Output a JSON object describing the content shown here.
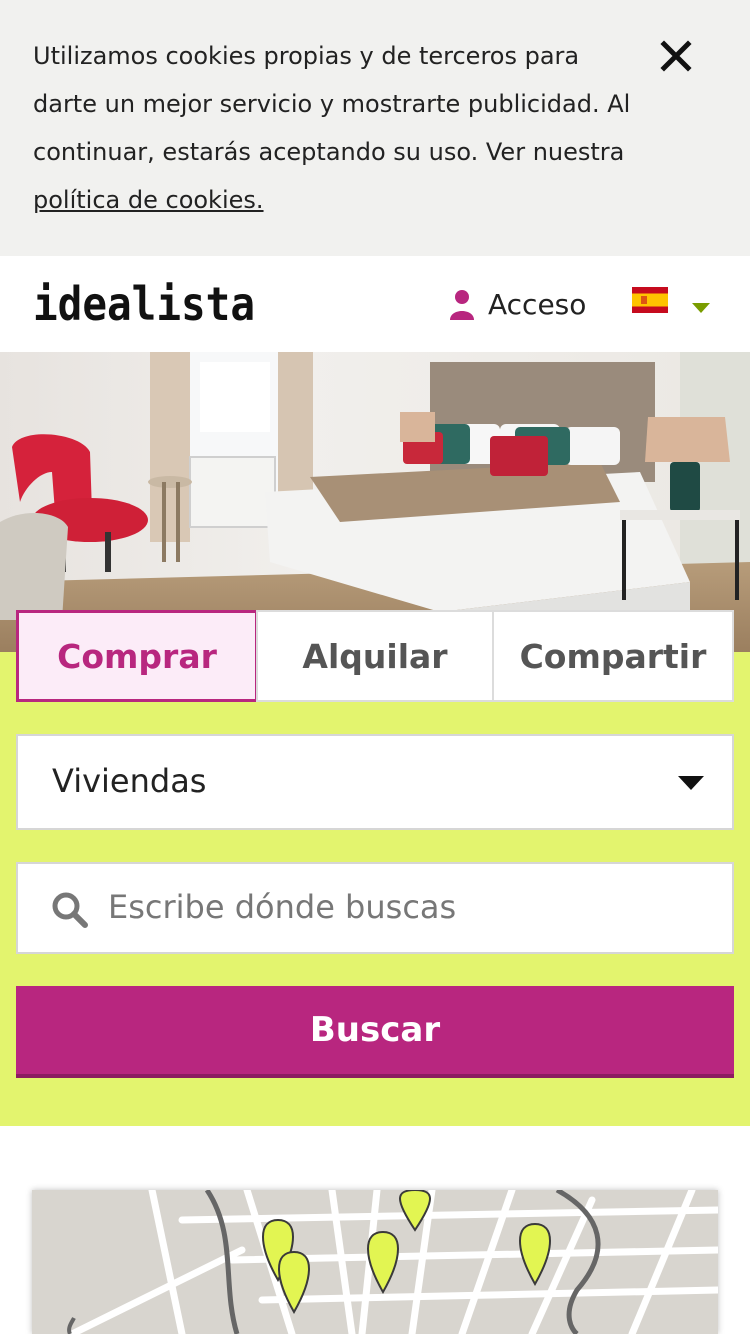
{
  "cookie_banner": {
    "text_before_link": "Utilizamos cookies propias y de terceros para darte un mejor servicio y mostrarte publicidad. Al continuar, estarás aceptando su uso. Ver nuestra ",
    "link_text": "política de cookies."
  },
  "header": {
    "logo": "idealista",
    "login_label": "Acceso"
  },
  "search": {
    "tabs": [
      {
        "label": "Comprar"
      },
      {
        "label": "Alquilar"
      },
      {
        "label": "Compartir"
      }
    ],
    "property_type": "Viviendas",
    "location_placeholder": "Escribe dónde buscas",
    "submit_label": "Buscar"
  },
  "colors": {
    "brand": "#b8267f",
    "panel": "#e3f46e",
    "map_marker": "#e2f552"
  },
  "icons": [
    "close-icon",
    "user-icon",
    "spain-flag-icon",
    "chevron-down-icon",
    "search-icon",
    "map-marker-icon"
  ]
}
